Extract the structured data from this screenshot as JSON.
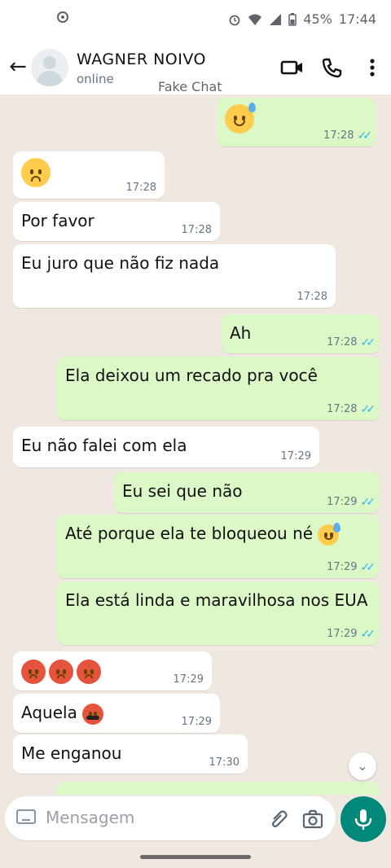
{
  "status_bar": {
    "battery": "45%",
    "time": "17:44"
  },
  "header": {
    "contact_name": "WAGNER NOIVO",
    "presence": "online",
    "watermark": "Fake Chat"
  },
  "messages": [
    {
      "dir": "out",
      "emoji": "grinning-sweat",
      "time": "17:28",
      "read": true
    },
    {
      "dir": "in",
      "emoji": "worried-face",
      "time": "17:28"
    },
    {
      "dir": "in",
      "text": "Por favor",
      "time": "17:28"
    },
    {
      "dir": "in",
      "text": "Eu juro que não fiz nada",
      "time": "17:28"
    },
    {
      "dir": "out",
      "text": "Ah",
      "time": "17:28",
      "read": true
    },
    {
      "dir": "out",
      "text": "Ela deixou um recado pra você",
      "time": "17:28",
      "read": true
    },
    {
      "dir": "in",
      "text": "Eu não falei com ela",
      "time": "17:29"
    },
    {
      "dir": "out",
      "text": "Eu sei que não",
      "time": "17:29",
      "read": true
    },
    {
      "dir": "out",
      "text": "Até porque ela te bloqueou né",
      "emoji": "grinning-sweat",
      "time": "17:29",
      "read": true
    },
    {
      "dir": "out",
      "text": "Ela está linda e maravilhosa nos EUA",
      "time": "17:29",
      "read": true
    },
    {
      "dir": "in",
      "emoji": "angry-face x3",
      "time": "17:29"
    },
    {
      "dir": "in",
      "text": "Aquela",
      "emoji": "face-with-symbols",
      "time": "17:29"
    },
    {
      "dir": "in",
      "text": "Me enganou",
      "time": "17:30"
    }
  ],
  "composer": {
    "placeholder": "Mensagem"
  },
  "colors": {
    "incoming": "#ffffff",
    "outgoing": "#dcf8c6",
    "chat_bg": "#efe8e0",
    "accent": "#00897b",
    "read_ticks": "#34b7f1"
  }
}
